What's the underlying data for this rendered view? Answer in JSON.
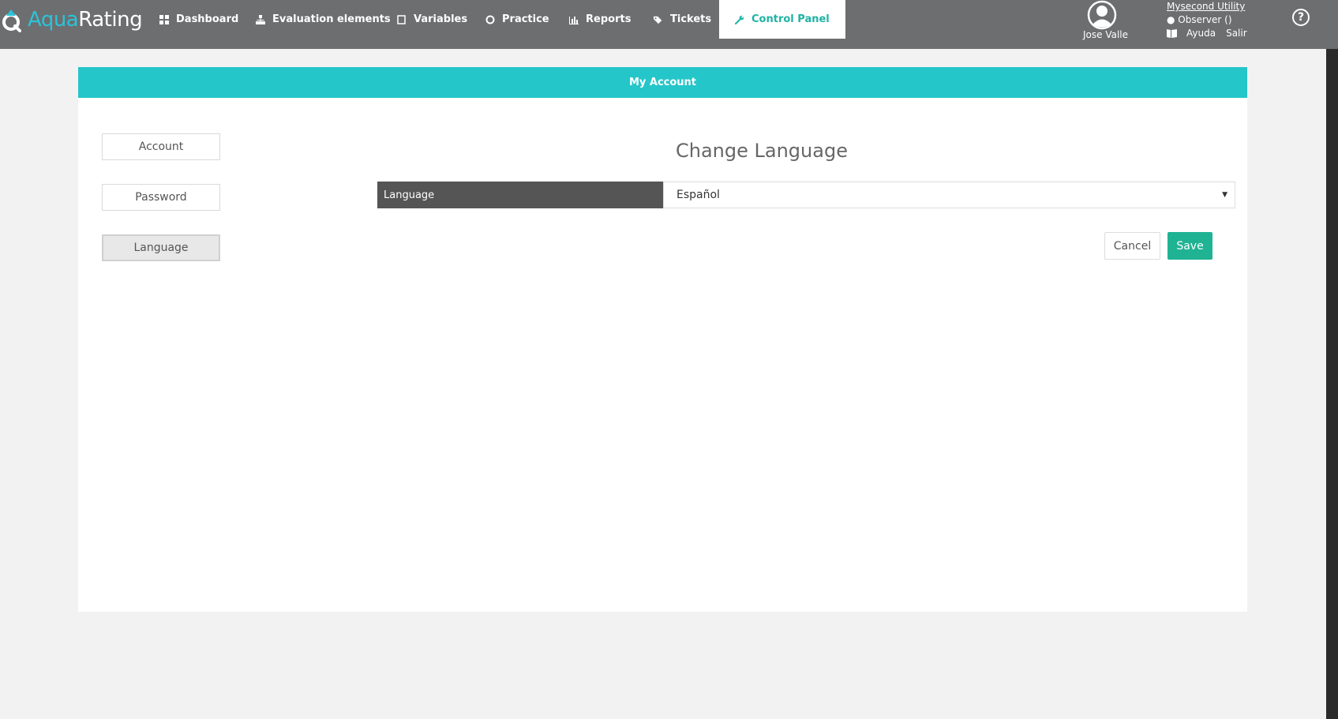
{
  "brand": {
    "part1": "Aqua",
    "part2": "Rating",
    "aqua_color": "#29c4d9"
  },
  "nav": {
    "items": [
      {
        "label": "Dashboard",
        "icon": "grid-icon"
      },
      {
        "label": "Evaluation elements",
        "icon": "sitemap-icon"
      },
      {
        "label": "Variables",
        "icon": "square-icon"
      },
      {
        "label": "Practice",
        "icon": "circle-icon"
      },
      {
        "label": "Reports",
        "icon": "bar-chart-icon"
      },
      {
        "label": "Tickets",
        "icon": "tags-icon"
      },
      {
        "label": "Control Panel",
        "icon": "wrench-icon",
        "active": true
      }
    ]
  },
  "user": {
    "name": "Jose Valle",
    "org": "Mysecond Utility",
    "role": "● Observer ()",
    "help": "Ayuda",
    "logout": "Salir"
  },
  "help_icon": "?",
  "panel": {
    "title": "My Account",
    "sidebar": [
      {
        "label": "Account"
      },
      {
        "label": "Password"
      },
      {
        "label": "Language",
        "active": true
      }
    ],
    "section_title": "Change Language",
    "field_label": "Language",
    "field_value": "Español",
    "cancel_label": "Cancel",
    "save_label": "Save"
  },
  "colors": {
    "navbar": "#6d6e70",
    "header": "#25c6c9",
    "save": "#1fb393",
    "active_tab_text": "#1fb3a5"
  }
}
